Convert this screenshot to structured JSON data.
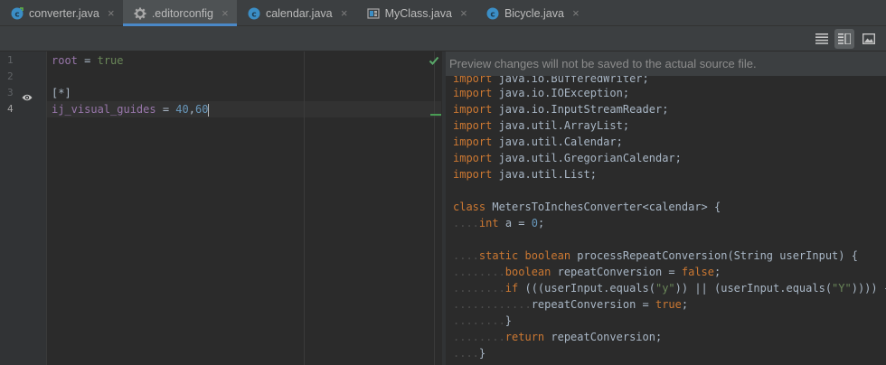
{
  "tabs": [
    {
      "label": "converter.java",
      "icon": "java-class-icon",
      "active": false
    },
    {
      "label": ".editorconfig",
      "icon": "gear-icon",
      "active": true
    },
    {
      "label": "calendar.java",
      "icon": "java-class-icon",
      "active": false
    },
    {
      "label": "MyClass.java",
      "icon": "java-structure-icon",
      "active": false
    },
    {
      "label": "Bicycle.java",
      "icon": "java-class-icon",
      "active": false
    }
  ],
  "toolbar": {
    "buttons": [
      "editor-only-icon",
      "editor-and-preview-icon",
      "preview-only-icon"
    ],
    "selected": "editor-and-preview-icon"
  },
  "editor": {
    "line_numbers": [
      "1",
      "2",
      "3",
      "4"
    ],
    "current_line": "4",
    "lines": {
      "l1_key": "root",
      "l1_eq": " = ",
      "l1_val": "true",
      "l3_section": "[*]",
      "l4_key": "ij_visual_guides",
      "l4_eq": " = ",
      "l4_v1": "40",
      "l4_comma": ",",
      "l4_v2": "60"
    }
  },
  "preview": {
    "banner": "Preview changes will not be saved to the actual source file.",
    "code": {
      "imp0": "import",
      "imp0_rest": " java.io.BufferedWriter;",
      "imp1": "import",
      "imp1_rest": " java.io.IOException;",
      "imp2": "import",
      "imp2_rest": " java.io.InputStreamReader;",
      "imp3": "import",
      "imp3_rest": " java.util.ArrayList;",
      "imp4": "import",
      "imp4_rest": " java.util.Calendar;",
      "imp5": "import",
      "imp5_rest": " java.util.GregorianCalendar;",
      "imp6": "import",
      "imp6_rest": " java.util.List;",
      "class_kw": "class",
      "class_rest": " MetersToInchesConverter<calendar> {",
      "ws1": "....",
      "int_kw": "int",
      "int_a": " a = ",
      "int_num": "0",
      "int_end": ";",
      "ws2": "....",
      "static_kw": "static",
      "boolean_kw": " boolean",
      "method_sig": " processRepeatConversion(String userInput) {",
      "ws3": "........",
      "bool2_kw": "boolean",
      "rc_assign": " repeatConversion = ",
      "false_kw": "false",
      "semi1": ";",
      "ws4": "........",
      "if_kw": "if",
      "if_a": " (((userInput.equals(",
      "str_y": "\"y\"",
      "if_b": ")) || (userInput.equals(",
      "str_Y": "\"Y\"",
      "if_c": ")))) {",
      "ws5": "............",
      "rc2": "repeatConversion = ",
      "true_kw": "true",
      "semi2": ";",
      "ws6": "........",
      "close1": "}",
      "ws7": "........",
      "return_kw": "return",
      "return_rest": " repeatConversion;",
      "ws8": "....",
      "close2": "}"
    }
  },
  "colors": {
    "accent": "#4a88c7",
    "keyword": "#cc7832",
    "string": "#6a8759",
    "number": "#6897bb",
    "function": "#ffc66d",
    "config_key": "#9876aa"
  }
}
